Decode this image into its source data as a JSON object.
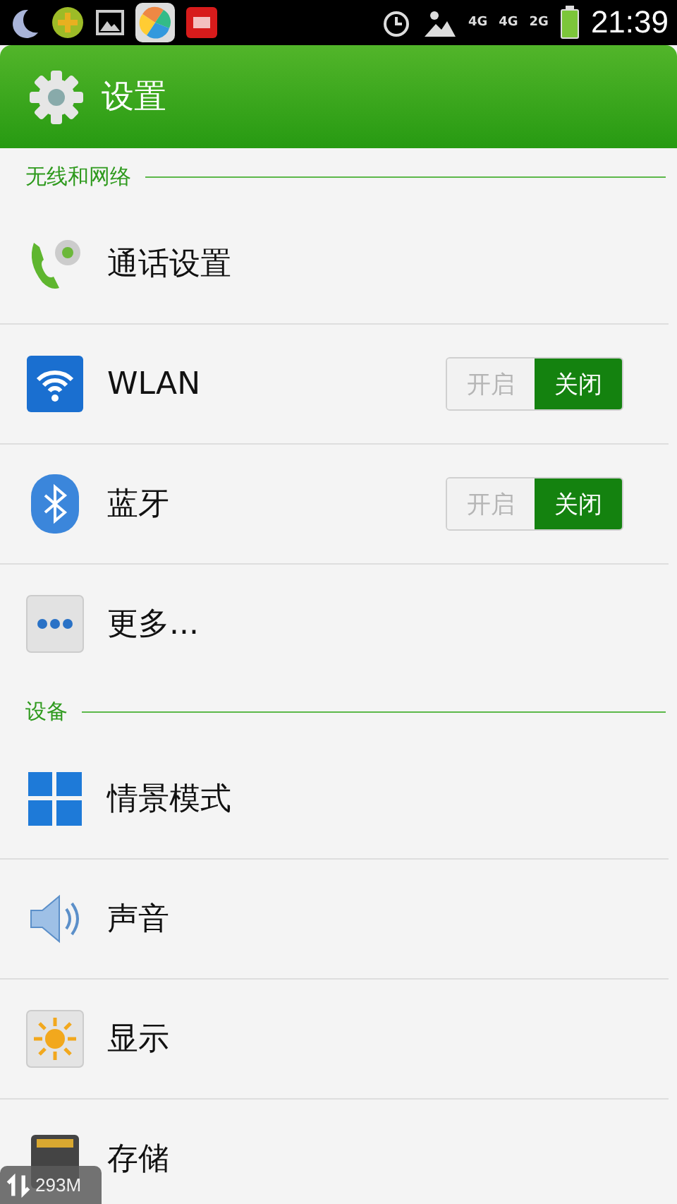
{
  "status_bar": {
    "network_type": "4G",
    "sim_1": "4G",
    "sim_2": "2G",
    "time": "21:39"
  },
  "header": {
    "title": "设置"
  },
  "sections": [
    {
      "title": "无线和网络",
      "items": [
        {
          "kind": "plain",
          "label": "通话设置"
        },
        {
          "kind": "toggle",
          "label": "WLAN",
          "on_label": "开启",
          "off_label": "关闭",
          "on": false
        },
        {
          "kind": "toggle",
          "label": "蓝牙",
          "on_label": "开启",
          "off_label": "关闭",
          "on": false
        },
        {
          "kind": "plain",
          "label": "更多..."
        }
      ]
    },
    {
      "title": "设备",
      "items": [
        {
          "kind": "plain",
          "label": "情景模式"
        },
        {
          "kind": "plain",
          "label": "声音"
        },
        {
          "kind": "plain",
          "label": "显示"
        },
        {
          "kind": "plain",
          "label": "存储"
        }
      ]
    }
  ],
  "floating_widget": {
    "memory": "293M"
  }
}
